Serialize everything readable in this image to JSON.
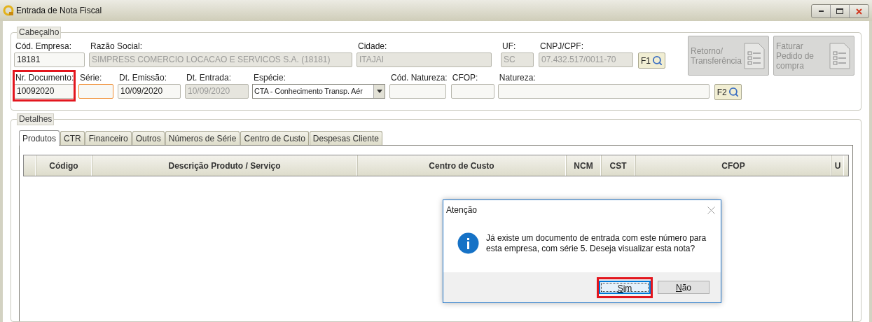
{
  "window": {
    "title": "Entrada de Nota Fiscal"
  },
  "header": {
    "title": "Cabeçalho",
    "row_1": [
      {
        "label": "Cód. Empresa:",
        "value": "18181",
        "kind": "text",
        "disabled": false,
        "highlight": false,
        "focused": false
      },
      {
        "label": "Razão Social:",
        "value": "SIMPRESS COMERCIO LOCACAO E SERVICOS S.A. (18181)",
        "kind": "text",
        "disabled": true,
        "highlight": false,
        "focused": false
      },
      {
        "label": "Cidade:",
        "value": "ITAJAI",
        "kind": "text",
        "disabled": true,
        "highlight": false,
        "focused": false
      },
      {
        "label": "UF:",
        "value": "SC",
        "kind": "text",
        "disabled": true,
        "highlight": false,
        "focused": false
      },
      {
        "label": "CNPJ/CPF:",
        "value": "07.432.517/0011-70",
        "kind": "text",
        "disabled": true,
        "highlight": false,
        "focused": false
      }
    ],
    "search_1": "F1",
    "row_2": [
      {
        "label": "Nr. Documento:",
        "value": "10092020",
        "kind": "text",
        "disabled": false,
        "highlight": true,
        "focused": false
      },
      {
        "label": "Série:",
        "kind": "text",
        "disabled": false,
        "highlight": false,
        "focused": true
      },
      {
        "label": "Dt. Emissão:",
        "value": "10/09/2020",
        "kind": "text",
        "disabled": false,
        "highlight": false,
        "focused": false
      },
      {
        "label": "Dt. Entrada:",
        "value": "10/09/2020",
        "kind": "text",
        "disabled": true,
        "highlight": false,
        "focused": false
      },
      {
        "label": "Espécie:",
        "value": "CTA - Conhecimento Transp. Aér",
        "kind": "combo",
        "disabled": false,
        "highlight": false,
        "focused": false
      },
      {
        "label": "Cód. Natureza:",
        "kind": "text",
        "disabled": false,
        "highlight": false,
        "focused": false
      },
      {
        "label": "CFOP:",
        "kind": "text",
        "disabled": false,
        "highlight": false,
        "focused": false
      },
      {
        "label": "Natureza:",
        "kind": "text",
        "disabled": false,
        "highlight": false,
        "focused": false
      }
    ],
    "search_2": "F2",
    "actions": [
      {
        "label": "Retorno/ Transferência",
        "disabled": true
      },
      {
        "label": "Faturar Pedido de compra",
        "disabled": true
      }
    ]
  },
  "details": {
    "title": "Detalhes",
    "tabs": [
      {
        "label": "Produtos",
        "selected": true
      },
      {
        "label": "CTR",
        "selected": false
      },
      {
        "label": "Financeiro",
        "selected": false
      },
      {
        "label": "Outros",
        "selected": false
      },
      {
        "label": "Números de Série",
        "selected": false
      },
      {
        "label": "Centro de Custo",
        "selected": false
      },
      {
        "label": "Despesas Cliente",
        "selected": false
      }
    ],
    "table": {
      "columns": [
        "Código",
        "Descrição Produto / Serviço",
        "Centro de Custo",
        "NCM",
        "CST",
        "CFOP",
        "U"
      ]
    }
  },
  "dialog": {
    "title": "Atenção",
    "message": "Já existe um documento de entrada com este número para esta empresa, com série 5. Deseja visualizar esta nota?",
    "buttons": [
      {
        "label": "Sim",
        "default": true,
        "highlight": true
      },
      {
        "label": "Não",
        "default": false,
        "highlight": false
      }
    ]
  }
}
